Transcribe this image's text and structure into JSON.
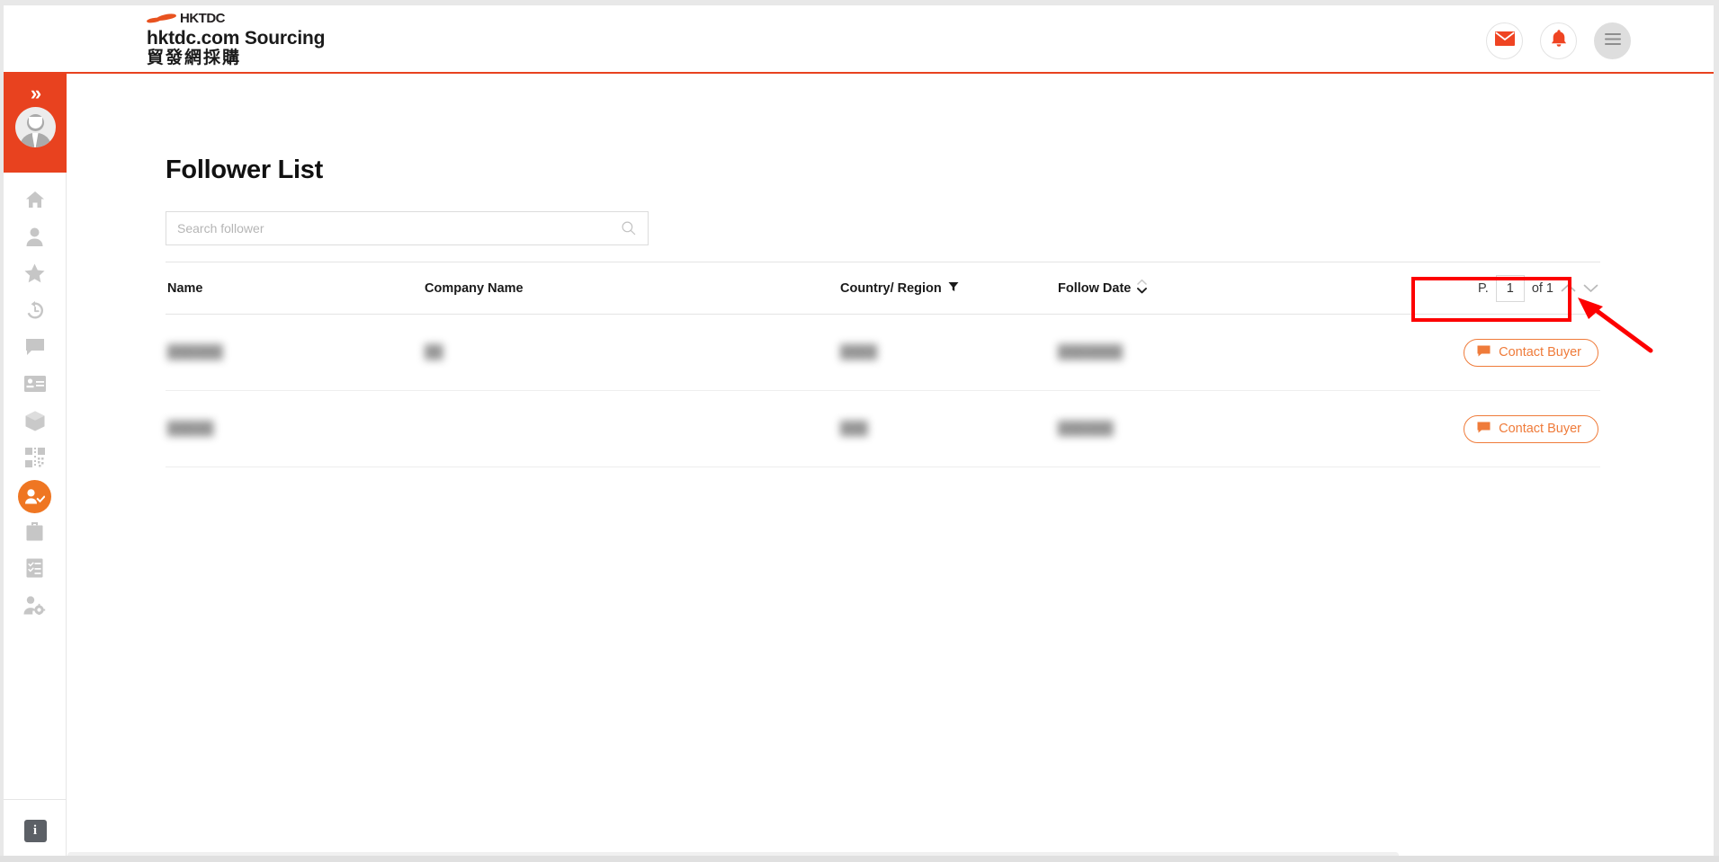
{
  "brand": {
    "logo_text": "HKTDC",
    "title": "hktdc.com Sourcing",
    "subtitle": "貿發網採購",
    "accent_color": "#e8421f"
  },
  "header": {
    "actions": [
      {
        "name": "mail-icon",
        "label": "Messages"
      },
      {
        "name": "bell-icon",
        "label": "Notifications"
      },
      {
        "name": "hamburger-menu-icon",
        "label": "Menu"
      }
    ]
  },
  "sidebar": {
    "expand_icon": "»",
    "avatar": "user-avatar",
    "items": [
      {
        "icon": "home-icon",
        "label": "Home",
        "active": false
      },
      {
        "icon": "person-icon",
        "label": "Profile",
        "active": false
      },
      {
        "icon": "star-icon",
        "label": "Favourites",
        "active": false
      },
      {
        "icon": "history-icon",
        "label": "History",
        "active": false
      },
      {
        "icon": "chat-icon",
        "label": "Messages",
        "active": false
      },
      {
        "icon": "id-card-icon",
        "label": "Company Card",
        "active": false
      },
      {
        "icon": "box-icon",
        "label": "Products",
        "active": false
      },
      {
        "icon": "qr-code-icon",
        "label": "QR Code",
        "active": false
      },
      {
        "icon": "follower-icon",
        "label": "Follower List",
        "active": true
      },
      {
        "icon": "bag-icon",
        "label": "Orders",
        "active": false
      },
      {
        "icon": "clipboard-icon",
        "label": "Tasks",
        "active": false
      },
      {
        "icon": "account-settings-icon",
        "label": "Account Settings",
        "active": false
      }
    ],
    "footer": {
      "icon": "info-icon",
      "label": "i"
    },
    "active_color": "#ef7622"
  },
  "main": {
    "page_title": "Follower List",
    "search": {
      "placeholder": "Search follower",
      "value": "",
      "icon": "search-icon"
    },
    "table": {
      "columns": [
        {
          "key": "name",
          "label": "Name",
          "icon": null
        },
        {
          "key": "company",
          "label": "Company Name",
          "icon": null
        },
        {
          "key": "country",
          "label": "Country/ Region",
          "icon": "filter-icon"
        },
        {
          "key": "date",
          "label": "Follow Date",
          "icon": "sort-icon"
        }
      ],
      "rows": [
        {
          "name": "██████",
          "company": "██",
          "country": "████",
          "date": "███████",
          "action_label": "Contact Buyer",
          "action_icon": "chat-bubble-icon",
          "highlighted": true
        },
        {
          "name": "█████",
          "company": "",
          "country": "███",
          "date": "██████",
          "action_label": "Contact Buyer",
          "action_icon": "chat-bubble-icon",
          "highlighted": false
        }
      ]
    },
    "pagination": {
      "prefix": "P.",
      "current_page": "1",
      "of_label": "of 1",
      "prev_icon": "chevron-up-icon",
      "next_icon": "chevron-down-icon"
    }
  },
  "annotation": {
    "color": "#fd0000",
    "target": "contact-buyer-button-row-1",
    "shape": "rectangle-with-arrow"
  }
}
